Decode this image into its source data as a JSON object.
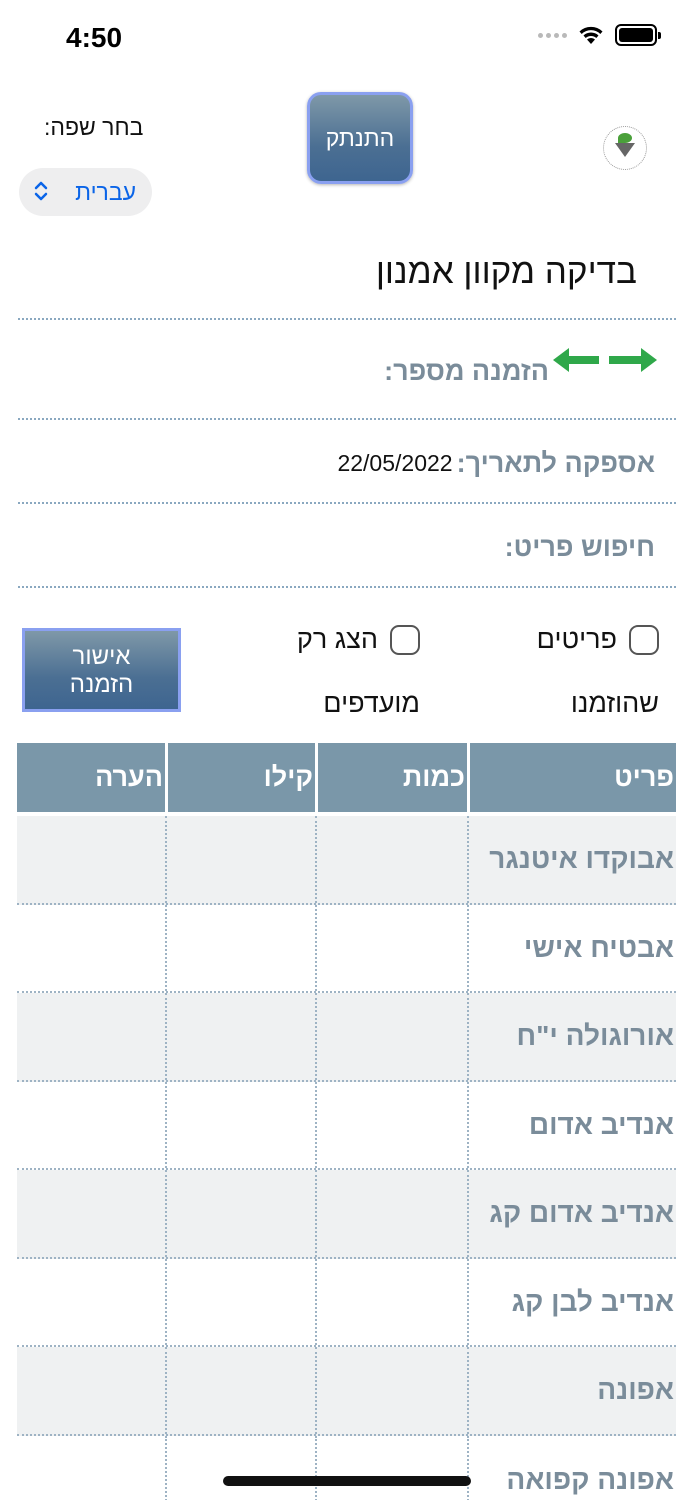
{
  "status_bar": {
    "time": "4:50"
  },
  "header": {
    "language_label": "בחר שפה:",
    "language_value": "עברית",
    "logout_label": "התנתק"
  },
  "page_title": "בדיקה מקוון אמנון",
  "order": {
    "number_label": "הזמנה מספר:",
    "number_value": "",
    "supply_label": "אספקה לתאריך:",
    "supply_date": "22/05/2022",
    "search_label": "חיפוש פריט:"
  },
  "filters": {
    "ordered_label_1": "פריטים",
    "ordered_label_2": "שהוזמנו",
    "favorites_label_1": "הצג רק",
    "favorites_label_2": "מועדפים",
    "confirm_label_1": "אישור",
    "confirm_label_2": "הזמנה"
  },
  "table": {
    "headers": [
      "פריט",
      "כמות",
      "קילו",
      "הערה"
    ],
    "rows": [
      {
        "item": "אבוקדו איטנגר",
        "qty": "",
        "kilo": "",
        "note": ""
      },
      {
        "item": "אבטיח אישי",
        "qty": "",
        "kilo": "",
        "note": ""
      },
      {
        "item": "אורוגולה י\"ח",
        "qty": "",
        "kilo": "",
        "note": ""
      },
      {
        "item": "אנדיב אדום",
        "qty": "",
        "kilo": "",
        "note": ""
      },
      {
        "item": "אנדיב אדום קג",
        "qty": "",
        "kilo": "",
        "note": ""
      },
      {
        "item": "אנדיב לבן קג",
        "qty": "",
        "kilo": "",
        "note": ""
      },
      {
        "item": "אפונה",
        "qty": "",
        "kilo": "",
        "note": ""
      },
      {
        "item": "אפונה קפואה",
        "qty": "",
        "kilo": "",
        "note": ""
      }
    ]
  },
  "icons": {
    "wifi": "wifi-icon",
    "battery": "battery-icon",
    "chevron": "chevron-up-down-icon",
    "arrows": "left-right-arrows-icon",
    "logo": "company-logo"
  },
  "colors": {
    "accent_blue": "#0a64e8",
    "header_bg": "#7a97a9",
    "button_bg": "#4b6f93",
    "arrow_green": "#2fa84a",
    "label_gray": "#7a8c9a"
  }
}
